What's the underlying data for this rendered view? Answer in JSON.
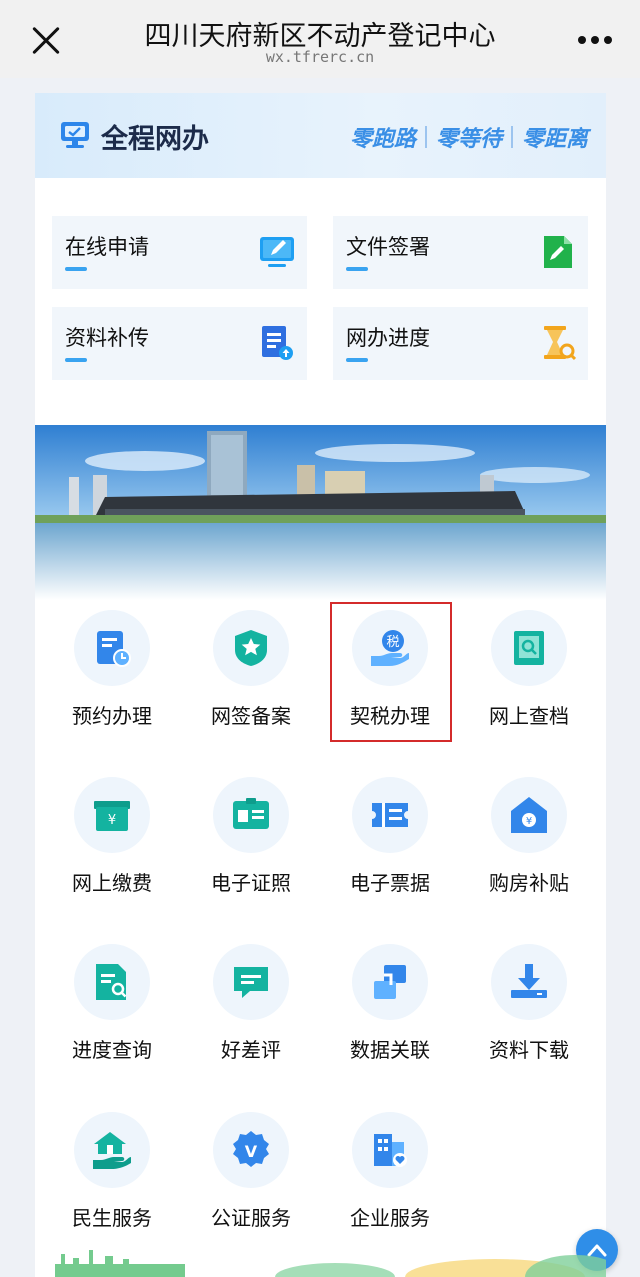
{
  "topbar": {
    "title": "四川天府新区不动产登记中心",
    "url": "wx.tfrerc.cn"
  },
  "online": {
    "title": "全程网办",
    "slogans": [
      "零跑路",
      "零等待",
      "零距离"
    ]
  },
  "quick_actions": [
    {
      "label": "在线申请",
      "icon": "monitor-edit-icon",
      "color": "#1e9ff2"
    },
    {
      "label": "文件签署",
      "icon": "document-sign-icon",
      "color": "#21b24b"
    },
    {
      "label": "资料补传",
      "icon": "document-upload-icon",
      "color": "#2f6fe0"
    },
    {
      "label": "网办进度",
      "icon": "hourglass-search-icon",
      "color": "#f2a51c"
    }
  ],
  "services": [
    {
      "label": "预约办理",
      "icon": "appointment-icon",
      "color": "#3286ea"
    },
    {
      "label": "网签备案",
      "icon": "badge-star-icon",
      "color": "#14b3a0"
    },
    {
      "label": "契税办理",
      "icon": "tax-hand-icon",
      "color": "#3286ea"
    },
    {
      "label": "网上查档",
      "icon": "search-archive-icon",
      "color": "#14b3a0"
    },
    {
      "label": "网上缴费",
      "icon": "payment-icon",
      "color": "#14b3a0"
    },
    {
      "label": "电子证照",
      "icon": "id-card-icon",
      "color": "#14b3a0"
    },
    {
      "label": "电子票据",
      "icon": "ticket-icon",
      "color": "#3286ea"
    },
    {
      "label": "购房补贴",
      "icon": "house-subsidy-icon",
      "color": "#3286ea"
    },
    {
      "label": "进度查询",
      "icon": "progress-search-icon",
      "color": "#14b3a0"
    },
    {
      "label": "好差评",
      "icon": "comment-icon",
      "color": "#14b3a0"
    },
    {
      "label": "数据关联",
      "icon": "data-link-icon",
      "color": "#3286ea"
    },
    {
      "label": "资料下载",
      "icon": "download-icon",
      "color": "#3286ea"
    },
    {
      "label": "民生服务",
      "icon": "home-hand-icon",
      "color": "#14b3a0"
    },
    {
      "label": "公证服务",
      "icon": "notary-badge-icon",
      "color": "#3286ea"
    },
    {
      "label": "企业服务",
      "icon": "enterprise-icon",
      "color": "#3286ea"
    }
  ],
  "highlighted_service": "契税办理",
  "tax_icon_text": "税"
}
